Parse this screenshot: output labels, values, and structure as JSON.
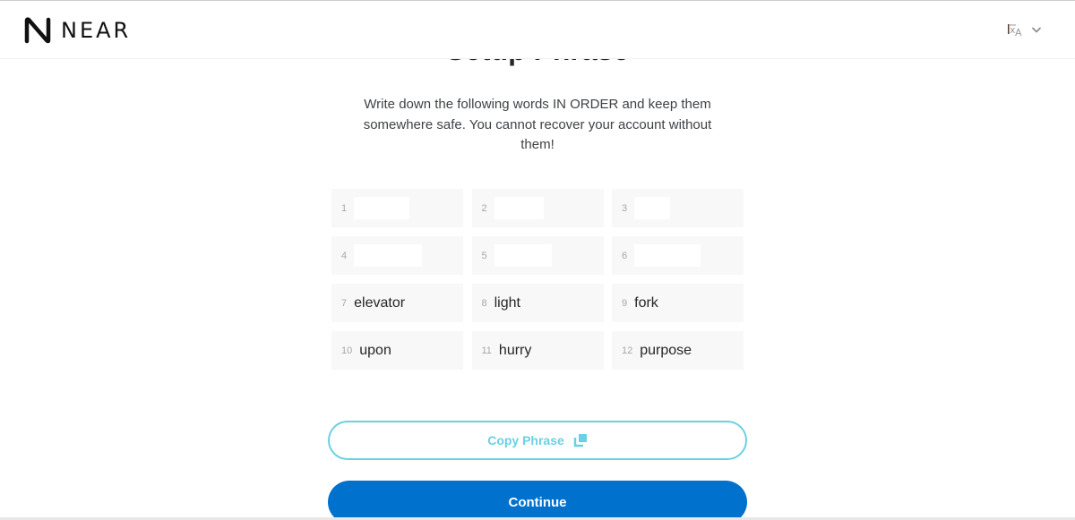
{
  "header": {
    "brand": "NEAR",
    "language_icon": "translate-icon",
    "dropdown_icon": "chevron-down-icon"
  },
  "main": {
    "title": "Setup Phrase",
    "description": "Write down the following words IN ORDER and keep them somewhere safe. You cannot recover your account without them!",
    "phrase": [
      {
        "num": "1",
        "word": "",
        "redacted": true
      },
      {
        "num": "2",
        "word": "",
        "redacted": true
      },
      {
        "num": "3",
        "word": "",
        "redacted": true
      },
      {
        "num": "4",
        "word": "",
        "redacted": true
      },
      {
        "num": "5",
        "word": "",
        "redacted": true
      },
      {
        "num": "6",
        "word": "",
        "redacted": true
      },
      {
        "num": "7",
        "word": "elevator"
      },
      {
        "num": "8",
        "word": "light"
      },
      {
        "num": "9",
        "word": "fork"
      },
      {
        "num": "10",
        "word": "upon"
      },
      {
        "num": "11",
        "word": "hurry"
      },
      {
        "num": "12",
        "word": "purpose"
      }
    ],
    "copy_button": {
      "label": "Copy Phrase",
      "icon": "copy-icon"
    },
    "continue_button": {
      "label": "Continue"
    }
  },
  "colors": {
    "accent": "#6ad1e3",
    "primary": "#0072ce",
    "cell_bg": "#f8f8f8"
  }
}
